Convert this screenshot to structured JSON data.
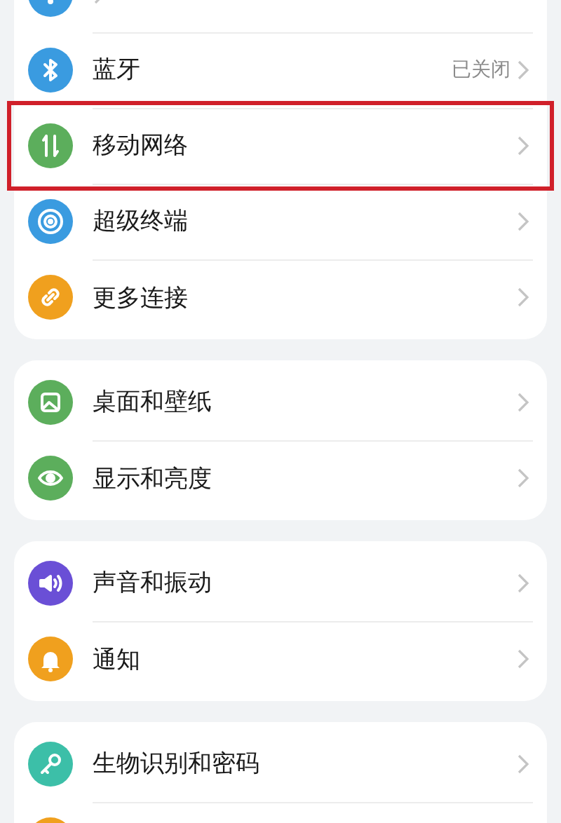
{
  "groups": [
    {
      "items": [
        {
          "kind": "wifi",
          "color": "#3a9be0",
          "highlighted": false
        },
        {
          "label": "蓝牙",
          "value": "已关闭",
          "kind": "bluetooth",
          "color": "#3a9be0",
          "highlighted": false
        },
        {
          "label": "移动网络",
          "kind": "arrows",
          "color": "#5cae5c",
          "highlighted": true
        },
        {
          "label": "超级终端",
          "kind": "rings",
          "color": "#3a9be0",
          "highlighted": false
        },
        {
          "label": "更多连接",
          "kind": "link",
          "color": "#f0a01e",
          "highlighted": false
        }
      ]
    },
    {
      "items": [
        {
          "label": "桌面和壁纸",
          "kind": "image",
          "color": "#5cae5c",
          "highlighted": false
        },
        {
          "label": "显示和亮度",
          "kind": "eye",
          "color": "#5cae5c",
          "highlighted": false
        }
      ]
    },
    {
      "items": [
        {
          "label": "声音和振动",
          "kind": "speaker",
          "color": "#6a4fd6",
          "highlighted": false
        },
        {
          "label": "通知",
          "kind": "bell",
          "color": "#f0a01e",
          "highlighted": false
        }
      ]
    },
    {
      "items": [
        {
          "label": "生物识别和密码",
          "kind": "key",
          "color": "#3cbfa8",
          "highlighted": false
        },
        {
          "kind": "blank",
          "color": "#f0a01e",
          "highlighted": false
        }
      ]
    }
  ]
}
